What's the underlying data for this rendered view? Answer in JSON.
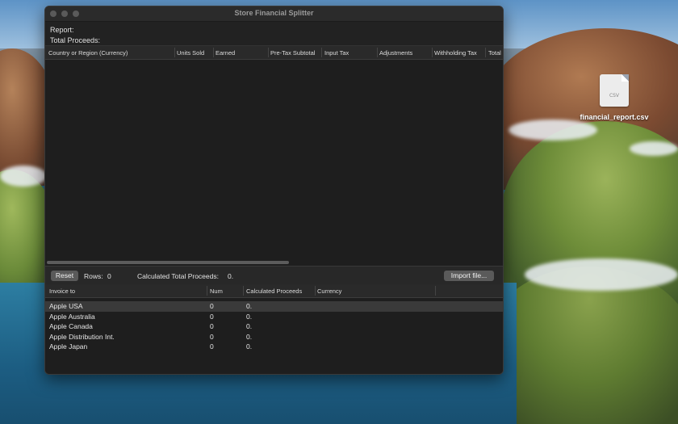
{
  "window": {
    "title": "Store Financial Splitter",
    "report_label": "Report:",
    "total_proceeds_label": "Total Proceeds:"
  },
  "report_table": {
    "columns": [
      "Country or Region (Currency)",
      "Units Sold",
      "Earned",
      "Pre-Tax Subtotal",
      "Input Tax",
      "Adjustments",
      "Withholding Tax",
      "Total"
    ],
    "rows": []
  },
  "toolbar": {
    "reset_label": "Reset",
    "rows_label": "Rows:",
    "rows_value": "0",
    "calc_total_label": "Calculated Total Proceeds:",
    "calc_total_value": "0.",
    "import_label": "Import file..."
  },
  "invoice_table": {
    "columns": [
      "Invoice to",
      "Num",
      "Calculated Proceeds",
      "Currency"
    ],
    "rows": [
      {
        "invoice_to": "Apple USA",
        "num": "0",
        "proceeds": "0.",
        "currency": ""
      },
      {
        "invoice_to": "Apple Australia",
        "num": "0",
        "proceeds": "0.",
        "currency": ""
      },
      {
        "invoice_to": "Apple Canada",
        "num": "0",
        "proceeds": "0.",
        "currency": ""
      },
      {
        "invoice_to": "Apple Distribution Int.",
        "num": "0",
        "proceeds": "0.",
        "currency": ""
      },
      {
        "invoice_to": "Apple Japan",
        "num": "0",
        "proceeds": "0.",
        "currency": ""
      }
    ],
    "selected_row": 0
  },
  "desktop": {
    "file_name": "financial_report.csv",
    "file_icon": "csv-file-icon",
    "file_icon_text": "CSV"
  },
  "colors": {
    "window_bg": "#222222",
    "header_bg": "#2a2a2a",
    "button_bg": "#5a5a5a",
    "selection_bg": "#3a3a3a"
  }
}
